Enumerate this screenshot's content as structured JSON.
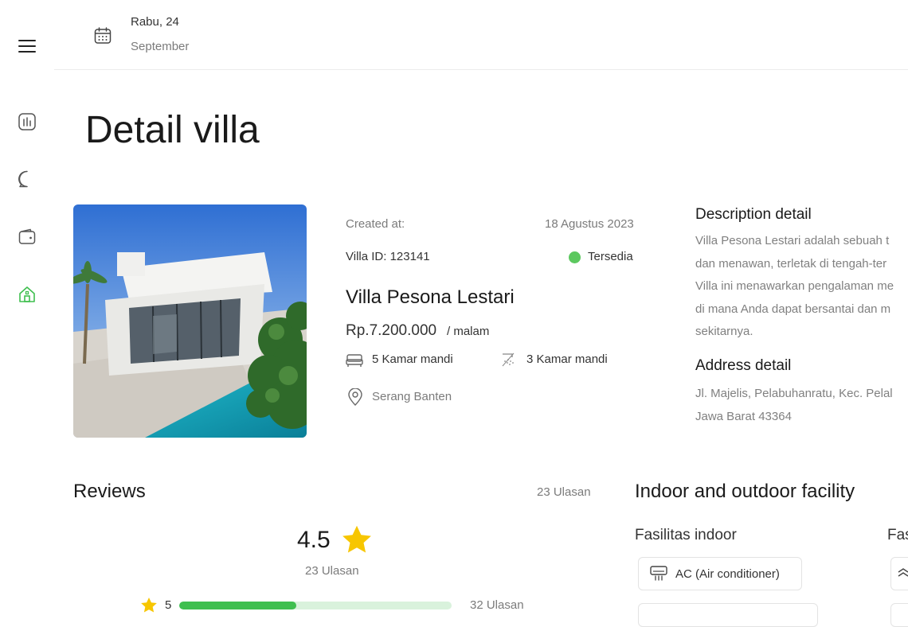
{
  "header": {
    "date_day": "Rabu, 24",
    "date_month": "September"
  },
  "page": {
    "title": "Detail villa"
  },
  "villa": {
    "created_label": "Created at:",
    "created_value": "18 Agustus 2023",
    "id_label": "Villa ID: 123141",
    "status": "Tersedia",
    "status_color": "#5cc85f",
    "name": "Villa Pesona Lestari",
    "price": "Rp.7.200.000",
    "price_unit": "/ malam",
    "bedrooms": "5 Kamar mandi",
    "bathrooms": "3 Kamar mandi",
    "location": "Serang Banten"
  },
  "description": {
    "title": "Description detail",
    "lines": [
      "Villa Pesona Lestari adalah sebuah t",
      "dan menawan, terletak di tengah-ter",
      "Villa ini menawarkan pengalaman me",
      "di mana Anda dapat bersantai dan m",
      "sekitarnya."
    ]
  },
  "address": {
    "title": "Address detail",
    "lines": [
      "Jl. Majelis, Pelabuhanratu, Kec. Pelal",
      "Jawa Barat 43364"
    ]
  },
  "reviews": {
    "title": "Reviews",
    "count_label": "23 Ulasan",
    "average": "4.5",
    "average_sub": "23 Ulasan",
    "rows": [
      {
        "star": "5",
        "fraction": 0.43,
        "count": "32 Ulasan"
      }
    ]
  },
  "facilities": {
    "title": "Indoor and outdoor facility",
    "indoor_title": "Fasilitas indoor",
    "outdoor_title": "Fas",
    "indoor_items": [
      "AC (Air conditioner)"
    ]
  },
  "colors": {
    "accent": "#3fbf4f",
    "star": "#f7c600"
  },
  "icons": {
    "menu": "hamburger-icon",
    "calendar": "calendar-icon",
    "dashboard": "chart-icon",
    "chat": "chat-icon",
    "wallet": "wallet-icon",
    "home": "home-icon"
  }
}
